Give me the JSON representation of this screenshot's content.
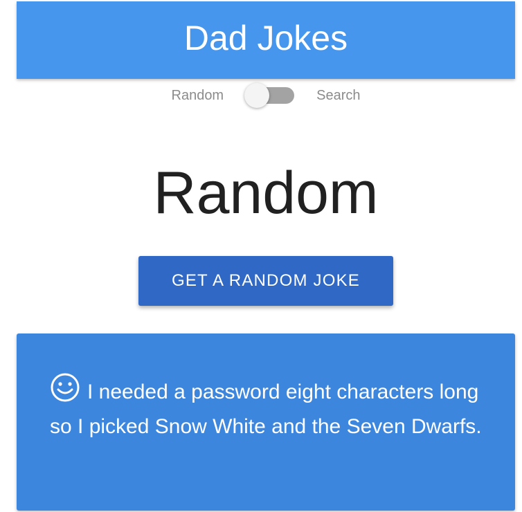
{
  "header": {
    "title": "Dad Jokes"
  },
  "toggle": {
    "left_label": "Random",
    "right_label": "Search",
    "state": "Random"
  },
  "main": {
    "section_title": "Random",
    "button_label": "GET A RANDOM JOKE"
  },
  "joke": {
    "icon": "smile-icon",
    "text": "I needed a password eight characters long so I picked Snow White and the Seven Dwarfs."
  },
  "colors": {
    "header": "#4596ec",
    "button": "#2f68c5",
    "card": "#3d86de"
  }
}
